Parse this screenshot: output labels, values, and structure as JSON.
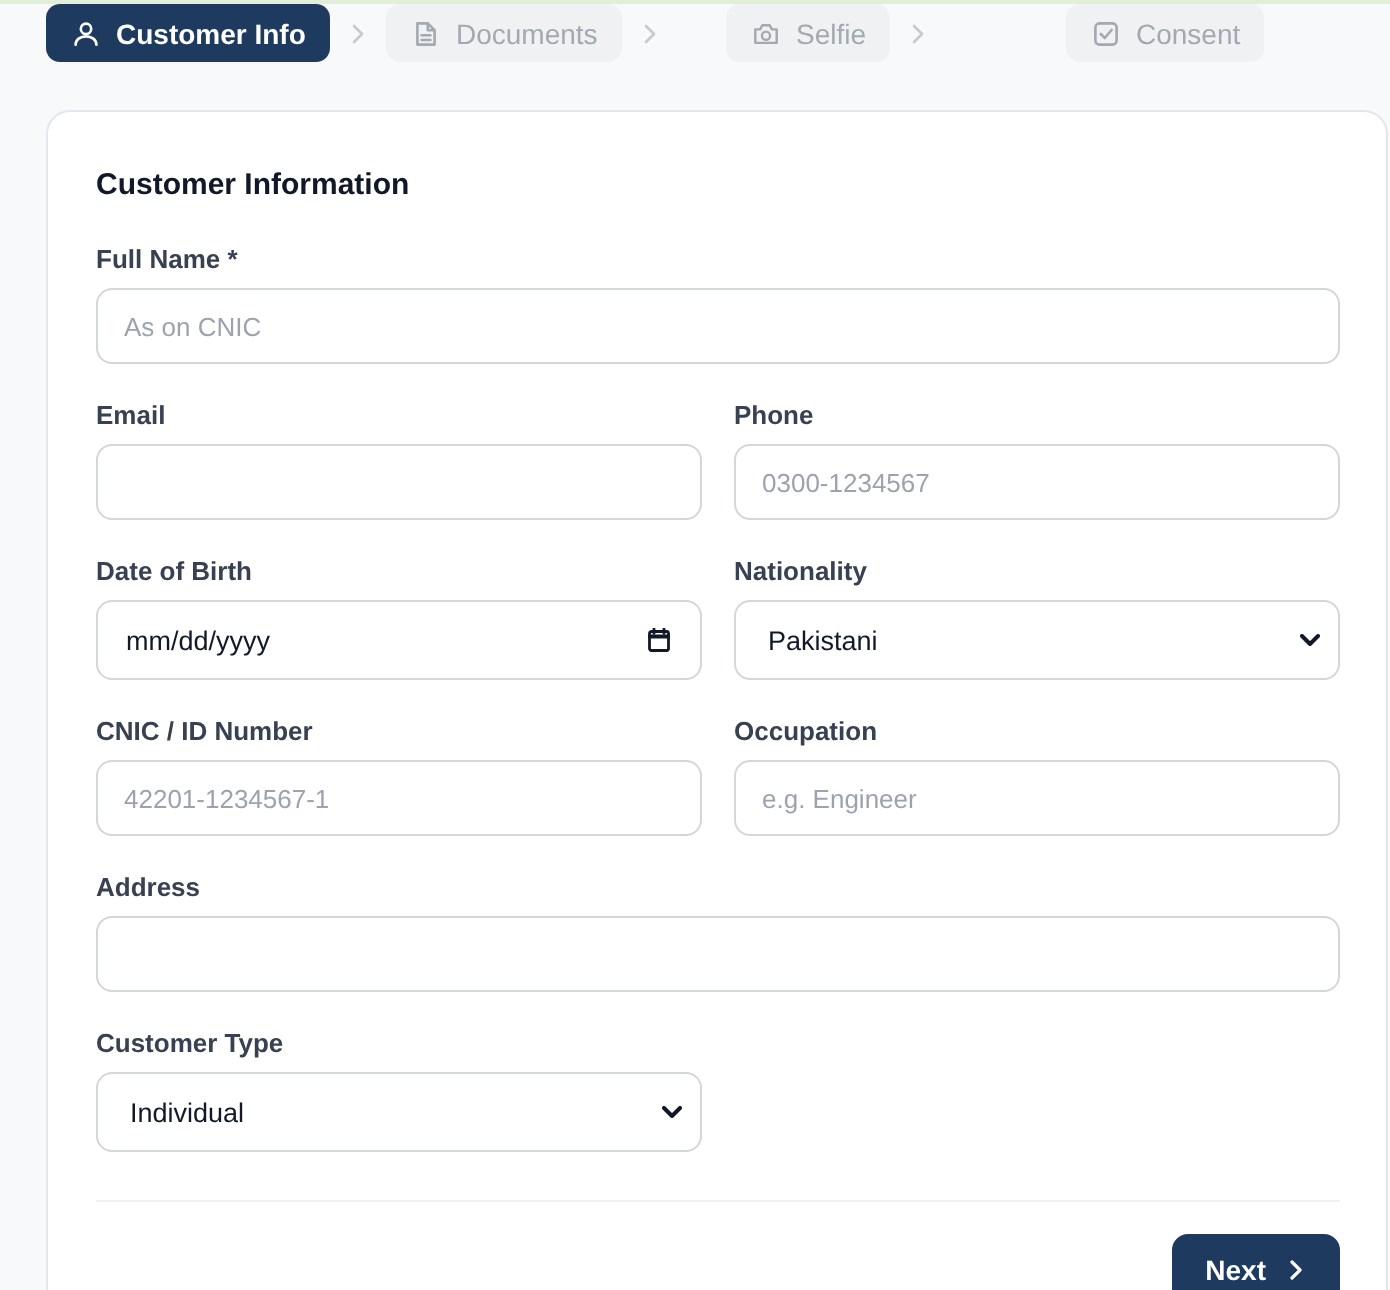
{
  "steps": [
    {
      "label": "Customer Info",
      "selected": true
    },
    {
      "label": "Documents",
      "selected": false
    },
    {
      "label": "Selfie",
      "selected": false
    },
    {
      "label": "Consent",
      "selected": false
    }
  ],
  "form": {
    "title": "Customer Information",
    "fields": [
      {
        "label": "Full Name *",
        "kind": "text",
        "wide": true,
        "placeholder": "As on CNIC"
      },
      {
        "label": "Email",
        "kind": "text",
        "wide": false
      },
      {
        "label": "Phone",
        "kind": "text",
        "wide": false,
        "placeholder": "0300-1234567"
      },
      {
        "label": "Date of Birth",
        "kind": "date",
        "wide": false,
        "placeholder": "mm/dd/yyyy"
      },
      {
        "label": "Nationality",
        "kind": "select",
        "wide": false,
        "value": "Pakistani"
      },
      {
        "label": "CNIC / ID Number",
        "kind": "text",
        "wide": false,
        "placeholder": "42201-1234567-1"
      },
      {
        "label": "Occupation",
        "kind": "text",
        "wide": false,
        "placeholder": "e.g. Engineer"
      },
      {
        "label": "Address",
        "kind": "text",
        "wide": true
      },
      {
        "label": "Customer Type",
        "kind": "select",
        "wide": false,
        "value": "Individual"
      }
    ],
    "next_button": {
      "label": "Next"
    }
  }
}
